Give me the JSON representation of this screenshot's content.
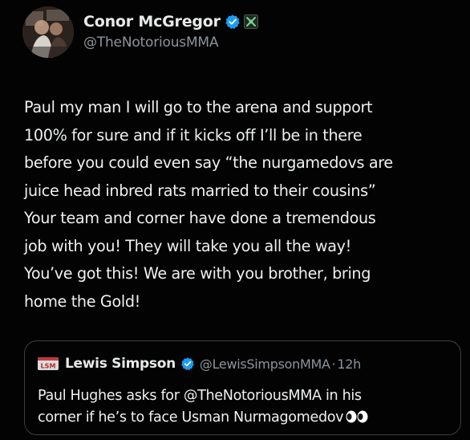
{
  "tweet": {
    "author": {
      "display_name": "Conor McGregor",
      "handle": "@TheNotoriousMMA",
      "verified": true,
      "avatar_icon": "profile-photo",
      "affiliate_icon": "affiliate-badge-icon"
    },
    "text_lines": [
      "Paul my man I will go to the arena and support",
      "100% for sure and if it kicks off I’ll be in there",
      "before you could even say “the nurgamedovs are",
      "juice head inbred rats married to their cousins”",
      "Your team and corner have done a tremendous",
      "job with you! They will take you all the way!",
      "You’ve got this! We are with you brother, bring",
      "home the Gold!"
    ]
  },
  "quoted_tweet": {
    "display_name": "Lewis Simpson",
    "handle": "@LewisSimpsonMMA",
    "separator": "·",
    "time": "12h",
    "verified": true,
    "avatar_icon": "lsm-logo-icon",
    "text_lines": [
      "Paul Hughes asks for @TheNotoriousMMA in his",
      "corner if he’s to face Usman Nurmagomedov"
    ],
    "trailing_emoji_icon": "eyes-icon"
  },
  "colors": {
    "background": "#000000",
    "text_primary": "#e7e9ea",
    "text_secondary": "#8b949c",
    "verified_blue": "#1d9bf0",
    "quote_border": "#3a3f43"
  }
}
